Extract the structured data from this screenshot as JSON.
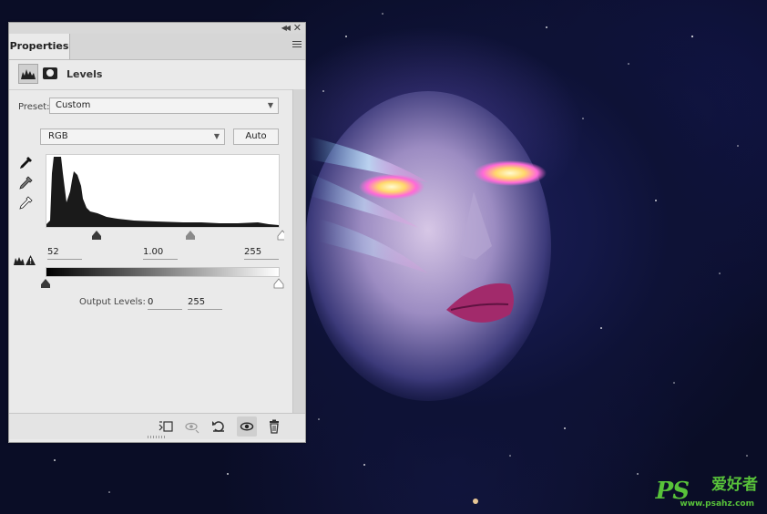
{
  "panel": {
    "tab_label": "Properties",
    "adjustment_title": "Levels",
    "preset_label": "Preset:",
    "preset_value": "Custom",
    "channel_value": "RGB",
    "auto_label": "Auto",
    "input_black": "52",
    "input_gamma": "1.00",
    "input_white": "255",
    "output_label": "Output Levels:",
    "output_black": "0",
    "output_white": "255"
  },
  "icons": {
    "header": [
      "levels-icon",
      "mask-icon"
    ],
    "eyedroppers": [
      "black-point-eyedropper-icon",
      "gray-point-eyedropper-icon",
      "white-point-eyedropper-icon"
    ],
    "footer": [
      "clip-to-layer-icon",
      "view-previous-state-icon",
      "reset-icon",
      "visibility-icon",
      "delete-icon"
    ]
  },
  "watermark": {
    "logo_text": "PS",
    "cn_text": "爱好者",
    "url": "www.psahz.com"
  },
  "colors": {
    "panel_bg": "#eaeaea",
    "watermark": "#58c23a",
    "space_bg": "#0a0d26"
  }
}
